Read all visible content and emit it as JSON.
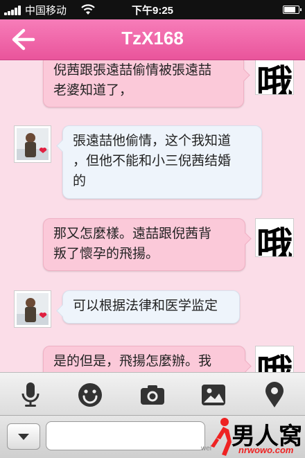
{
  "status_bar": {
    "carrier": "中国移动",
    "time": "下午9:25",
    "battery_level": 0.85
  },
  "nav": {
    "title": "TzX168",
    "back_icon": "left-arrow-icon"
  },
  "avatars": {
    "self_char": "哦"
  },
  "messages": [
    {
      "sender": "self",
      "lines": [
        "倪茜跟張遠喆偷情被張遠喆",
        "老婆知道了，"
      ]
    },
    {
      "sender": "other",
      "lines": [
        "張遠喆他偷情，这个我知道",
        "，但他不能和小三倪茜结婚",
        "的"
      ]
    },
    {
      "sender": "self",
      "lines": [
        "那又怎麼樣。遠喆跟倪茜背",
        "叛了懷孕的飛揚。"
      ]
    },
    {
      "sender": "other",
      "lines": [
        "可以根据法律和医学监定"
      ]
    },
    {
      "sender": "self",
      "lines": [
        "是的但是，飛揚怎麼辦。我"
      ]
    }
  ],
  "toolbar": {
    "icons": [
      "microphone-icon",
      "smiley-icon",
      "camera-icon",
      "image-icon",
      "location-pin-icon"
    ]
  },
  "input_bar": {
    "expand_icon": "chevron-down-icon",
    "message_value": "",
    "watermark_logo_text": "男人窝",
    "watermark_logo_url": "nrwowo.com",
    "watermark_small": "wei"
  },
  "colors": {
    "nav_pink": "#ee5fa5",
    "self_bubble": "#fbc9d9",
    "other_bubble": "#eef4fb",
    "chat_background": "#fbdde8"
  }
}
